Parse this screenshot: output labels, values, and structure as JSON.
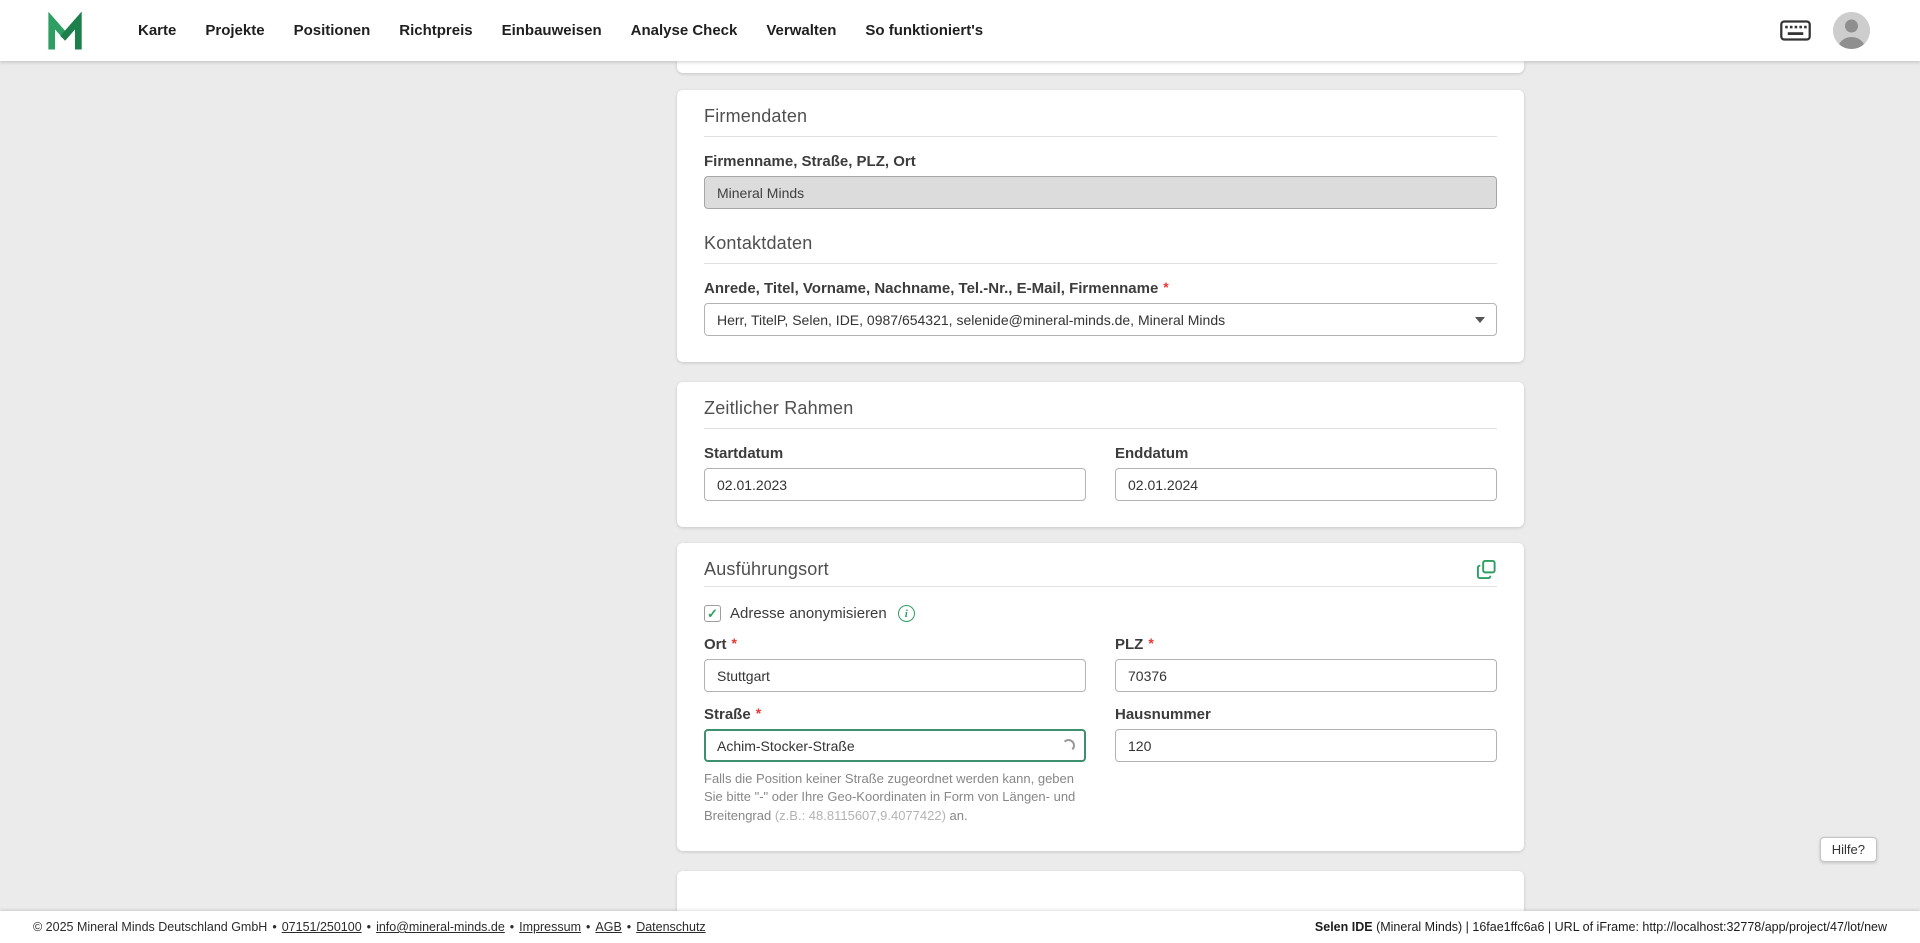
{
  "colors": {
    "accent": "#2f9e63",
    "required": "#e53935",
    "bg": "#ebebeb",
    "focus": "#3d8f6d"
  },
  "icons": {
    "check": "✓",
    "info": "i"
  },
  "required_marker": "*",
  "header": {
    "nav": [
      {
        "label": "Karte"
      },
      {
        "label": "Projekte"
      },
      {
        "label": "Positionen"
      },
      {
        "label": "Richtpreis"
      },
      {
        "label": "Einbauweisen"
      },
      {
        "label": "Analyse Check"
      },
      {
        "label": "Verwalten"
      },
      {
        "label": "So funktioniert's"
      }
    ]
  },
  "cards": {
    "firmendaten": {
      "title": "Firmendaten",
      "address_label": "Firmenname, Straße, PLZ, Ort",
      "address_value": "Mineral Minds",
      "kontakt_title": "Kontaktdaten",
      "kontakt_label": "Anrede, Titel, Vorname, Nachname, Tel.-Nr., E-Mail, Firmenname",
      "kontakt_value": "Herr, TitelP, Selen, IDE, 0987/654321, selenide@mineral-minds.de, Mineral Minds"
    },
    "zeitraum": {
      "title": "Zeitlicher Rahmen",
      "start_label": "Startdatum",
      "start_value": "02.01.2023",
      "end_label": "Enddatum",
      "end_value": "02.01.2024"
    },
    "ort": {
      "title": "Ausführungsort",
      "anonymize_label": "Adresse anonymisieren",
      "ort_label": "Ort",
      "ort_value": "Stuttgart",
      "plz_label": "PLZ",
      "plz_value": "70376",
      "strasse_label": "Straße",
      "strasse_value": "Achim-Stocker-Straße",
      "hausnummer_label": "Hausnummer",
      "hausnummer_value": "120",
      "hint_text": "Falls die Position keiner Straße zugeordnet werden kann, geben Sie bitte \"-\" oder Ihre Geo-Koordinaten in Form von Längen- und Breitengrad",
      "hint_coords": "(z.B.: 48.8115607,9.4077422)",
      "hint_suffix": "an."
    }
  },
  "help_button_label": "Hilfe?",
  "footer": {
    "copyright": "© 2025 Mineral Minds Deutschland GmbH",
    "separator": "•",
    "links": [
      {
        "label": "07151/250100"
      },
      {
        "label": "info@mineral-minds.de"
      },
      {
        "label": "Impressum"
      },
      {
        "label": "AGB"
      },
      {
        "label": "Datenschutz"
      }
    ],
    "right_bold": "Selen IDE",
    "right_rest": " (Mineral Minds) | 16fae1ffc6a6 | URL of iFrame: http://localhost:32778/app/project/47/lot/new"
  }
}
